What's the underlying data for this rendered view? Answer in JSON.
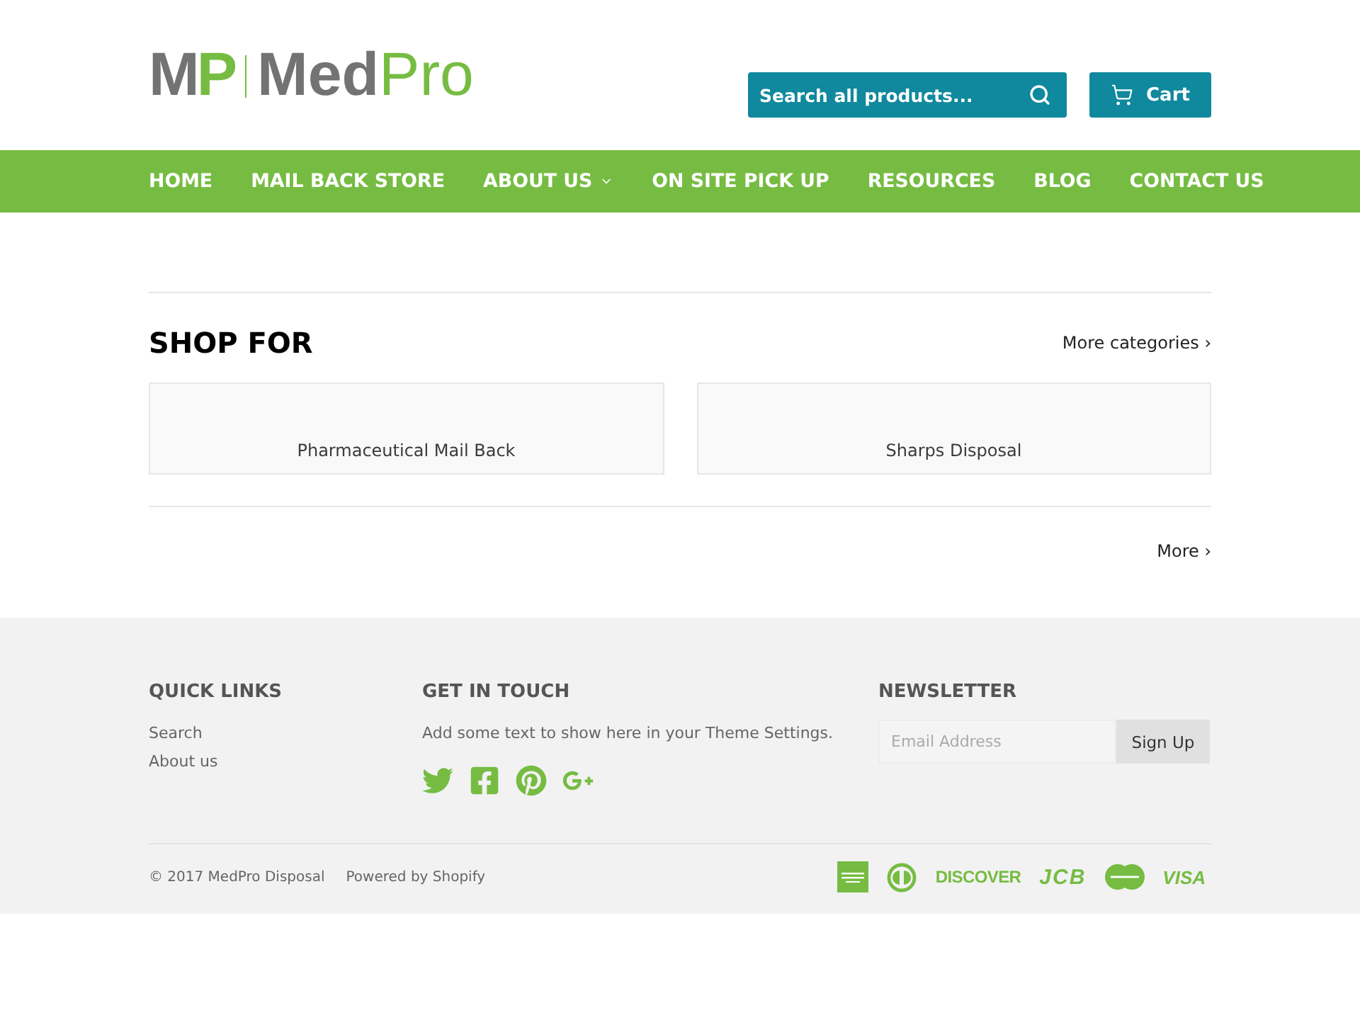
{
  "header": {
    "logo": {
      "mark_left": "M",
      "mark_right": "P",
      "name_bold": "Med",
      "name_light": "Pro"
    },
    "search": {
      "placeholder": "Search all products..."
    },
    "cart": {
      "label": "Cart"
    }
  },
  "nav": [
    {
      "label": "HOME",
      "dropdown": false
    },
    {
      "label": "MAIL BACK STORE",
      "dropdown": false
    },
    {
      "label": "ABOUT US",
      "dropdown": true
    },
    {
      "label": "ON SITE PICK UP",
      "dropdown": false
    },
    {
      "label": "RESOURCES",
      "dropdown": false
    },
    {
      "label": "BLOG",
      "dropdown": false
    },
    {
      "label": "CONTACT US",
      "dropdown": false
    }
  ],
  "section": {
    "title": "SHOP FOR",
    "more_link": "More categories ›",
    "cards": [
      {
        "label": "Pharmaceutical Mail Back"
      },
      {
        "label": "Sharps Disposal"
      }
    ],
    "footer_link": "More ›"
  },
  "footer": {
    "quick_links": {
      "title": "QUICK LINKS",
      "links": [
        "Search",
        "About us"
      ]
    },
    "contact": {
      "title": "GET IN TOUCH",
      "text": "Add some text to show here in your Theme Settings.",
      "social": [
        {
          "kind": "twitter"
        },
        {
          "kind": "facebook"
        },
        {
          "kind": "pinterest"
        },
        {
          "kind": "google_plus"
        }
      ]
    },
    "newsletter": {
      "title": "NEWSLETTER",
      "placeholder": "Email Address",
      "button": "Sign Up"
    },
    "bottom": {
      "copyright": "© 2017 MedPro Disposal",
      "powered": "Powered by Shopify",
      "payments": [
        {
          "kind": "amex"
        },
        {
          "kind": "diners"
        },
        {
          "kind": "discover",
          "label": "DISCOVER"
        },
        {
          "kind": "jcb",
          "label": "JCB"
        },
        {
          "kind": "mastercard"
        },
        {
          "kind": "visa",
          "label": "VISA"
        }
      ]
    }
  }
}
